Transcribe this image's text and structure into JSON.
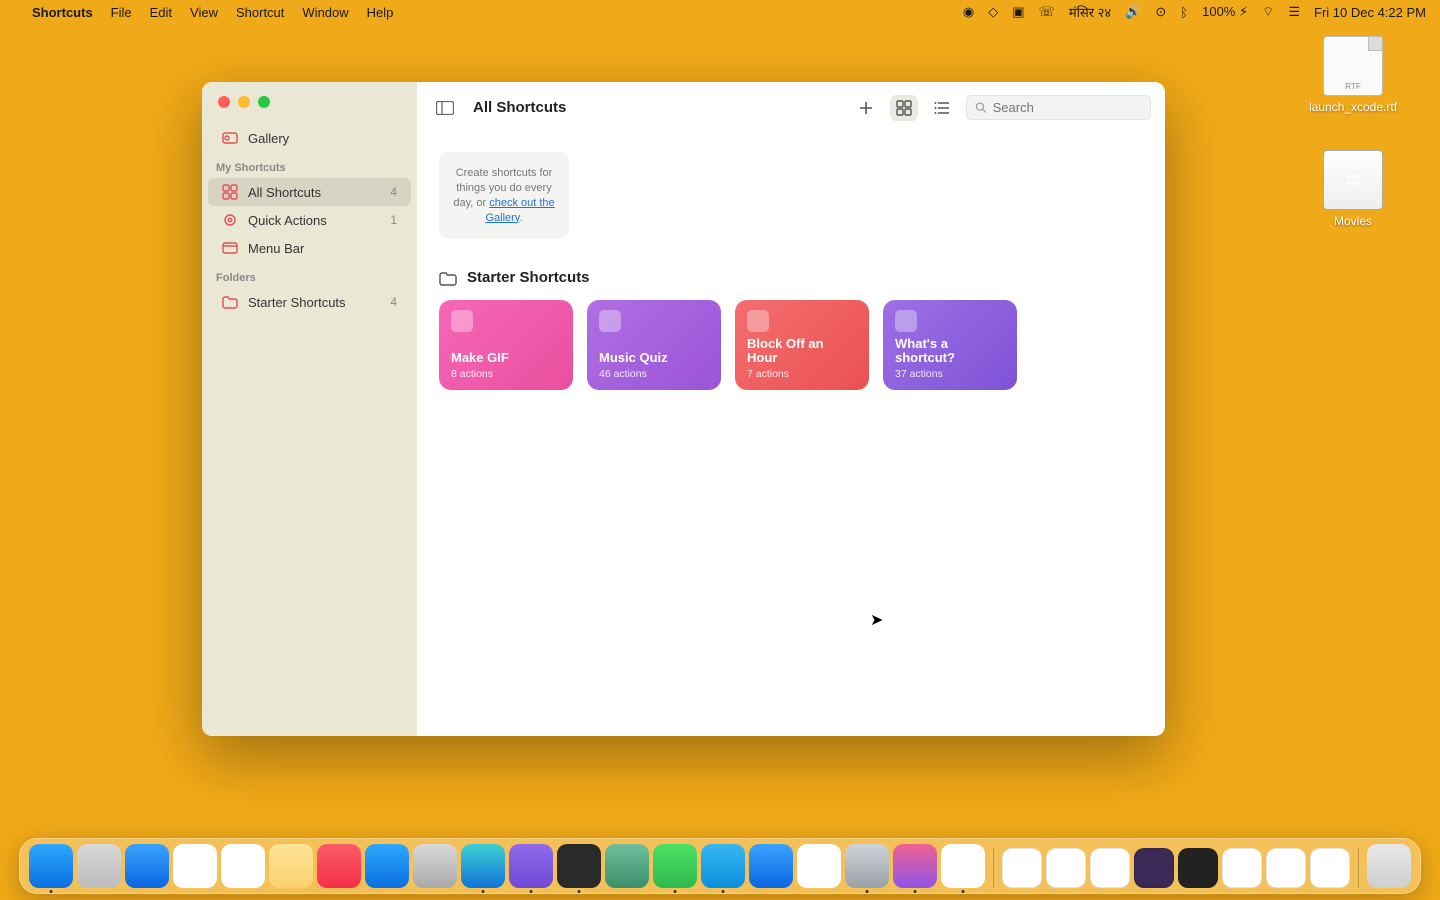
{
  "menubar": {
    "app_name": "Shortcuts",
    "menus": [
      "File",
      "Edit",
      "View",
      "Shortcut",
      "Window",
      "Help"
    ],
    "status": {
      "calendar": "मंसिर २४",
      "battery": "100%",
      "datetime": "Fri 10 Dec  4:22 PM"
    }
  },
  "desktop": {
    "rtf_label": "launch_xcode.rtf",
    "rtf_ext": "RTF",
    "movies_label": "Movies"
  },
  "window": {
    "title": "All Shortcuts",
    "search_placeholder": "Search",
    "tip_prefix": "Create shortcuts for things you do every day, or ",
    "tip_link": "check out the Gallery",
    "tip_suffix": "."
  },
  "sidebar": {
    "gallery": "Gallery",
    "section1": "My Shortcuts",
    "items": [
      {
        "label": "All Shortcuts",
        "count": "4"
      },
      {
        "label": "Quick Actions",
        "count": "1"
      },
      {
        "label": "Menu Bar",
        "count": ""
      }
    ],
    "section2": "Folders",
    "folders": [
      {
        "label": "Starter Shortcuts",
        "count": "4"
      }
    ]
  },
  "section_title": "Starter Shortcuts",
  "cards": [
    {
      "title": "Make GIF",
      "sub": "8 actions",
      "bg": "linear-gradient(135deg,#F667B8,#E94F9E)"
    },
    {
      "title": "Music Quiz",
      "sub": "46 actions",
      "bg": "linear-gradient(135deg,#B06FE3,#9A54D6)"
    },
    {
      "title": "Block Off an Hour",
      "sub": "7 actions",
      "bg": "linear-gradient(135deg,#F46E70,#EA5152)"
    },
    {
      "title": "What's a shortcut?",
      "sub": "37 actions",
      "bg": "linear-gradient(135deg,#9E6FE5,#7E53D6)"
    }
  ],
  "dock": {
    "apps": [
      {
        "name": "finder",
        "bg": "linear-gradient(#2EA7FF,#0A6FE0)",
        "running": true
      },
      {
        "name": "launchpad",
        "bg": "linear-gradient(#d9d9d9,#bcbcbc)",
        "running": false
      },
      {
        "name": "mail",
        "bg": "linear-gradient(#3AA3FF,#0A67E0)",
        "running": false
      },
      {
        "name": "calendar",
        "bg": "#fff",
        "running": false
      },
      {
        "name": "reminders",
        "bg": "#fff",
        "running": false
      },
      {
        "name": "notes",
        "bg": "linear-gradient(#FFE49A,#F8D26B)",
        "running": false
      },
      {
        "name": "music",
        "bg": "linear-gradient(#FA5D6A,#F52E4A)",
        "running": false
      },
      {
        "name": "appstore",
        "bg": "linear-gradient(#2EA7FF,#0A6FE0)",
        "running": false
      },
      {
        "name": "settings",
        "bg": "linear-gradient(#d9d9d9,#a9a9a9)",
        "running": false
      },
      {
        "name": "edge",
        "bg": "linear-gradient(#3ECFD3,#1273D6)",
        "running": true
      },
      {
        "name": "viber",
        "bg": "linear-gradient(#8E6CEB,#6E49D5)",
        "running": true
      },
      {
        "name": "terminal",
        "bg": "#2a2a2a",
        "running": true
      },
      {
        "name": "app-b",
        "bg": "linear-gradient(#6fbf9b,#3a8f6b)",
        "running": false
      },
      {
        "name": "whatsapp",
        "bg": "linear-gradient(#4CE066,#2FB94C)",
        "running": true
      },
      {
        "name": "skype",
        "bg": "linear-gradient(#39B6F0,#0A8FDD)",
        "running": true
      },
      {
        "name": "xcode",
        "bg": "linear-gradient(#3AA3FF,#0A67E0)",
        "running": false
      },
      {
        "name": "photos",
        "bg": "#fff",
        "running": false
      },
      {
        "name": "preview",
        "bg": "linear-gradient(#cfd4da,#9aa0a8)",
        "running": true
      },
      {
        "name": "shortcuts",
        "bg": "linear-gradient(#F06292,#8E55E6)",
        "running": true
      },
      {
        "name": "textedit",
        "bg": "#fff",
        "running": true
      }
    ],
    "recents": [
      {
        "name": "doc1",
        "bg": "#fff"
      },
      {
        "name": "doc2",
        "bg": "#fff"
      },
      {
        "name": "doc3",
        "bg": "#fff"
      },
      {
        "name": "win1",
        "bg": "#3a2a55"
      },
      {
        "name": "win2",
        "bg": "#222"
      },
      {
        "name": "win3",
        "bg": "#fff"
      },
      {
        "name": "doc4",
        "bg": "#fff"
      },
      {
        "name": "doc5",
        "bg": "#fff"
      }
    ],
    "trash": {
      "name": "trash",
      "bg": "linear-gradient(#e8e8e8,#cfcfcf)"
    }
  }
}
